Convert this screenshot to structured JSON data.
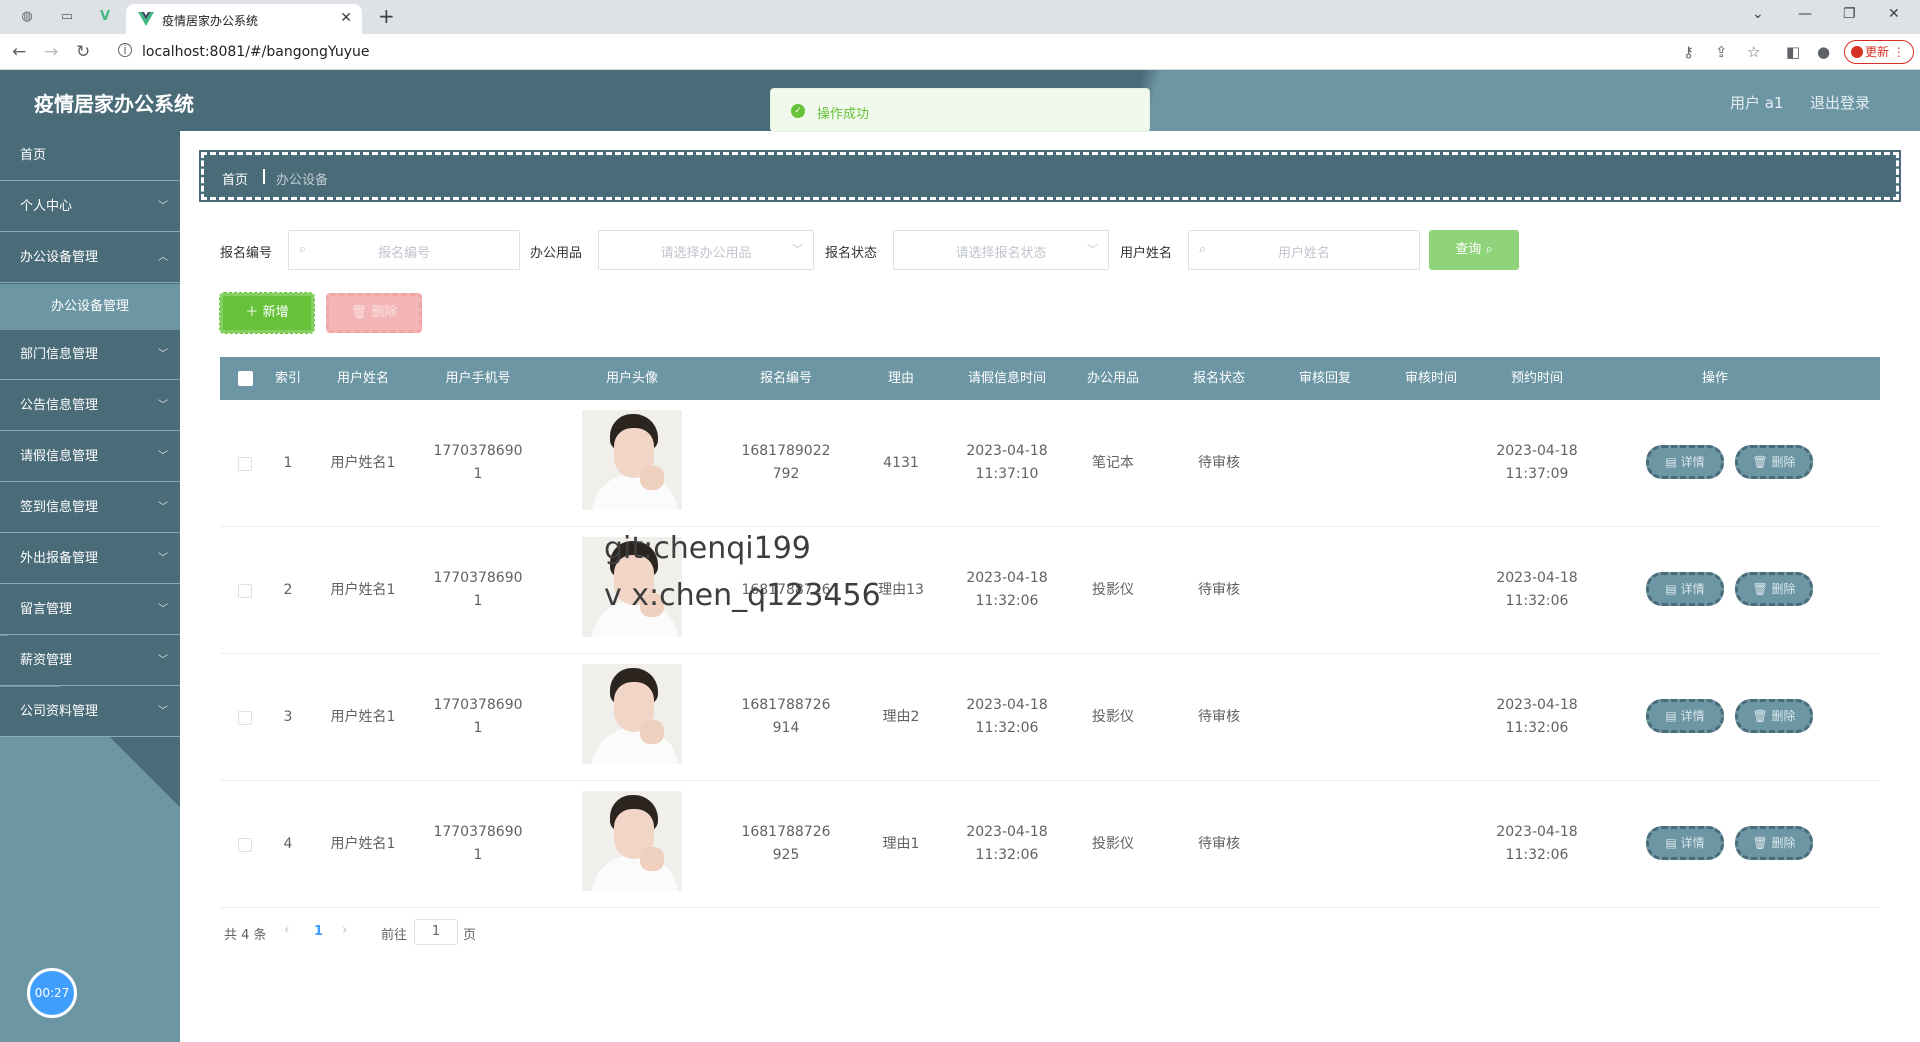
{
  "browser": {
    "tab_title": "疫情居家办公系统",
    "url": "localhost:8081/#/bangongYuyue",
    "update_label": "更新"
  },
  "header": {
    "title": "疫情居家办公系统",
    "user": "用户 a1",
    "logout": "退出登录"
  },
  "toast": {
    "message": "操作成功"
  },
  "sidebar": {
    "items": [
      {
        "label": "首页"
      },
      {
        "label": "个人中心"
      },
      {
        "label": "办公设备管理"
      },
      {
        "label": "部门信息管理"
      },
      {
        "label": "公告信息管理"
      },
      {
        "label": "请假信息管理"
      },
      {
        "label": "签到信息管理"
      },
      {
        "label": "外出报备管理"
      },
      {
        "label": "留言管理"
      },
      {
        "label": "薪资管理"
      },
      {
        "label": "公司资料管理"
      }
    ],
    "sub_item": "办公设备管理",
    "timer": "00:27"
  },
  "breadcrumb": {
    "home": "首页",
    "current": "办公设备"
  },
  "filters": {
    "reg_no_label": "报名编号",
    "reg_no_placeholder": "报名编号",
    "supplies_label": "办公用品",
    "supplies_placeholder": "请选择办公用品",
    "status_label": "报名状态",
    "status_placeholder": "请选择报名状态",
    "username_label": "用户姓名",
    "username_placeholder": "用户姓名",
    "search_label": "查询"
  },
  "actions": {
    "add_label": "新增",
    "delete_label": "删除"
  },
  "table": {
    "columns": [
      "索引",
      "用户姓名",
      "用户手机号",
      "用户头像",
      "报名编号",
      "理由",
      "请假信息时间",
      "办公用品",
      "报名状态",
      "审核回复",
      "审核时间",
      "预约时间",
      "操作"
    ],
    "rows": [
      {
        "index": "1",
        "name": "用户姓名1",
        "phone1": "1770378690",
        "phone2": "1",
        "regno1": "1681789022",
        "regno2": "792",
        "reason": "4131",
        "time1": "2023-04-18",
        "time2": "11:37:10",
        "supplies": "笔记本",
        "status": "待审核",
        "reply": "",
        "audit_time": "",
        "appt1": "2023-04-18",
        "appt2": "11:37:09"
      },
      {
        "index": "2",
        "name": "用户姓名1",
        "phone1": "1770378690",
        "phone2": "1",
        "regno1": "1681788726",
        "regno2": "",
        "reason": "理由13",
        "time1": "2023-04-18",
        "time2": "11:32:06",
        "supplies": "投影仪",
        "status": "待审核",
        "reply": "",
        "audit_time": "",
        "appt1": "2023-04-18",
        "appt2": "11:32:06"
      },
      {
        "index": "3",
        "name": "用户姓名1",
        "phone1": "1770378690",
        "phone2": "1",
        "regno1": "1681788726",
        "regno2": "914",
        "reason": "理由2",
        "time1": "2023-04-18",
        "time2": "11:32:06",
        "supplies": "投影仪",
        "status": "待审核",
        "reply": "",
        "audit_time": "",
        "appt1": "2023-04-18",
        "appt2": "11:32:06"
      },
      {
        "index": "4",
        "name": "用户姓名1",
        "phone1": "1770378690",
        "phone2": "1",
        "regno1": "1681788726",
        "regno2": "925",
        "reason": "理由1",
        "time1": "2023-04-18",
        "time2": "11:32:06",
        "supplies": "投影仪",
        "status": "待审核",
        "reply": "",
        "audit_time": "",
        "appt1": "2023-04-18",
        "appt2": "11:32:06"
      }
    ],
    "detail_label": "详情",
    "delete_label": "删除"
  },
  "watermark": {
    "line1": "git:chenqi199",
    "line2": "v x:chen_q123456"
  },
  "pager": {
    "total": "共 4 条",
    "current": "1",
    "goto": "前往",
    "page_input": "1",
    "page_suffix": "页"
  },
  "colors": {
    "primary": "#4a6b78",
    "secondary": "#6d96a5",
    "success": "#67c23a",
    "danger": "#f3b5b5"
  }
}
